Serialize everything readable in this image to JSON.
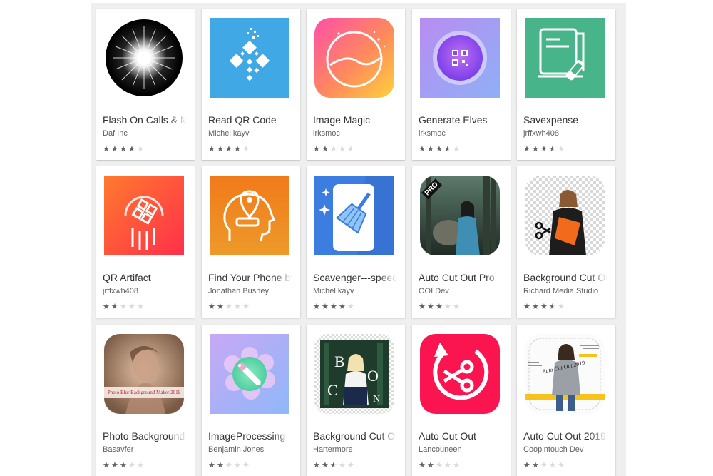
{
  "apps": [
    {
      "title": "Flash On Calls & Messages",
      "developer": "Daf Inc",
      "rating": 4,
      "icon": "flash-burst-icon"
    },
    {
      "title": "Read QR Code",
      "developer": "Michel kayv",
      "rating": 4,
      "icon": "qr-code-icon"
    },
    {
      "title": "Image Magic",
      "developer": "irksmoc",
      "rating": 2,
      "icon": "landscape-circle-icon"
    },
    {
      "title": "Generate Elves",
      "developer": "irksmoc",
      "rating": 3.5,
      "icon": "qr-button-icon"
    },
    {
      "title": "Savexpense",
      "developer": "jrffxwh408",
      "rating": 3.5,
      "icon": "document-pen-icon"
    },
    {
      "title": "QR Artifact",
      "developer": "jrffxwh408",
      "rating": 1.5,
      "icon": "qr-circle-icon"
    },
    {
      "title": "Find Your Phone by Whistle",
      "developer": "Jonathan Bushey",
      "rating": 2,
      "icon": "head-location-pin-icon"
    },
    {
      "title": "Scavenger---speed booster",
      "developer": "Michel kayv",
      "rating": 4,
      "icon": "phone-broom-icon"
    },
    {
      "title": "Auto Cut Out Pro",
      "developer": "OOI Dev",
      "rating": 3,
      "icon": "photo-woman-forest-icon"
    },
    {
      "title": "Background Cut Out",
      "developer": "Richard Media Studio",
      "rating": 3.5,
      "icon": "photo-woman-scissors-icon"
    },
    {
      "title": "Photo Background Blur",
      "developer": "Basavfer",
      "rating": 3,
      "icon": "photo-blur-woman-icon"
    },
    {
      "title": "ImageProcessing",
      "developer": "Benjamin Jones",
      "rating": 2,
      "icon": "flower-wand-icon"
    },
    {
      "title": "Background Cut Out",
      "developer": "Hartermore",
      "rating": 2.5,
      "icon": "photo-boo-woman-icon"
    },
    {
      "title": "Auto Cut Out",
      "developer": "Lancouneen",
      "rating": 2,
      "icon": "scissors-refresh-icon"
    },
    {
      "title": "Auto Cut Out 2019",
      "developer": "Coopintouch Dev",
      "rating": 2,
      "icon": "photo-autocut-woman-icon"
    }
  ],
  "icon_texts": {
    "pro_badge": "PRO",
    "blur_caption": "Photo Blur Background Maker 2019",
    "boo_b": "B",
    "boo_o1": "O",
    "boo_c": "C",
    "boo_n": "N",
    "autocut_caption": "Auto Cut Out 2019"
  },
  "colors": {
    "page_bg": "#efefef",
    "card_bg": "#ffffff",
    "title": "#333333",
    "developer": "#616161",
    "star_on": "#616161",
    "star_off": "#dadada"
  }
}
